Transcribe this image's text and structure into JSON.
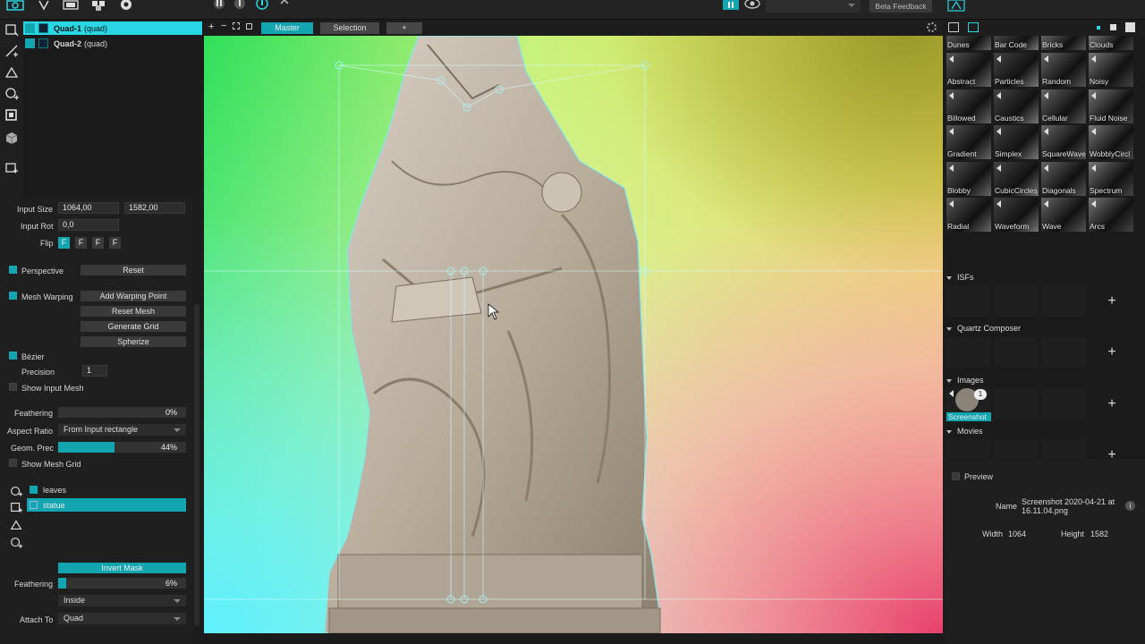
{
  "topbar": {
    "beta_label": "Beta Feedback"
  },
  "layers": [
    {
      "name": "Quad-1",
      "type": "(quad)",
      "selected": true
    },
    {
      "name": "Quad-2",
      "type": "(quad)",
      "selected": false
    }
  ],
  "props": {
    "input_size_label": "Input Size",
    "input_w": "1064,00",
    "input_h": "1582,00",
    "input_rot_label": "Input Rot",
    "input_rot": "0,0",
    "flip_label": "Flip",
    "flip_buttons": [
      "F",
      "F",
      "F",
      "F"
    ],
    "perspective_label": "Perspective",
    "reset_label": "Reset",
    "mesh_warping_label": "Mesh Warping",
    "add_warping_point": "Add Warping Point",
    "reset_mesh": "Reset Mesh",
    "generate_grid": "Generate Grid",
    "spherize": "Spherize",
    "bezier_label": "Bézier",
    "precision_label": "Precision",
    "precision_value": "1",
    "show_input_mesh": "Show Input Mesh",
    "feathering_label": "Feathering",
    "feathering_value": "0%",
    "feathering_fraction": 0,
    "aspect_ratio_label": "Aspect Ratio",
    "aspect_ratio_value": "From Input rectangle",
    "geom_prec_label": "Geom. Prec",
    "geom_prec_value": "44%",
    "geom_prec_fraction": 0.44,
    "show_mesh_grid": "Show Mesh Grid"
  },
  "masks": {
    "items": [
      {
        "name": "leaves",
        "selected": false
      },
      {
        "name": "statue",
        "selected": true
      }
    ],
    "invert_mask": "Invert Mask",
    "feathering_label": "Feathering",
    "feathering_value": "6%",
    "feathering_fraction": 0.06,
    "mode_value": "Inside",
    "attach_label": "Attach To",
    "attach_value": "Quad"
  },
  "canvas_tabs": {
    "master": "Master",
    "selection": "Selection",
    "add": "+"
  },
  "generators": [
    {
      "name": "Dunes"
    },
    {
      "name": "Bar Code"
    },
    {
      "name": "Bricks"
    },
    {
      "name": "Clouds"
    },
    {
      "name": "Abstract"
    },
    {
      "name": "Particles"
    },
    {
      "name": "Random"
    },
    {
      "name": "Noisy"
    },
    {
      "name": "Billowed"
    },
    {
      "name": "Caustics"
    },
    {
      "name": "Cellular"
    },
    {
      "name": "Fluid Noise"
    },
    {
      "name": "Gradient"
    },
    {
      "name": "Simplex"
    },
    {
      "name": "SquareWave"
    },
    {
      "name": "WobblyCircl"
    },
    {
      "name": "Blobby"
    },
    {
      "name": "CubicCircles"
    },
    {
      "name": "Diagonals"
    },
    {
      "name": "Spectrum"
    },
    {
      "name": "Radial"
    },
    {
      "name": "Waveform"
    },
    {
      "name": "Wave"
    },
    {
      "name": "Arcs"
    }
  ],
  "sections": {
    "isfs": "ISFs",
    "quartz": "Quartz Composer",
    "images": "Images",
    "movies": "Movies"
  },
  "image_item": {
    "name": "Screenshot",
    "badge": "1"
  },
  "plus": "+",
  "info": {
    "preview_label": "Preview",
    "name_label": "Name",
    "name_value": "Screenshot 2020-04-21 at 16.11.04.png",
    "width_label": "Width",
    "width_value": "1064",
    "height_label": "Height",
    "height_value": "1582"
  },
  "colors": {
    "accent": "#13a5b0",
    "accent_bright": "#29d6e4"
  }
}
